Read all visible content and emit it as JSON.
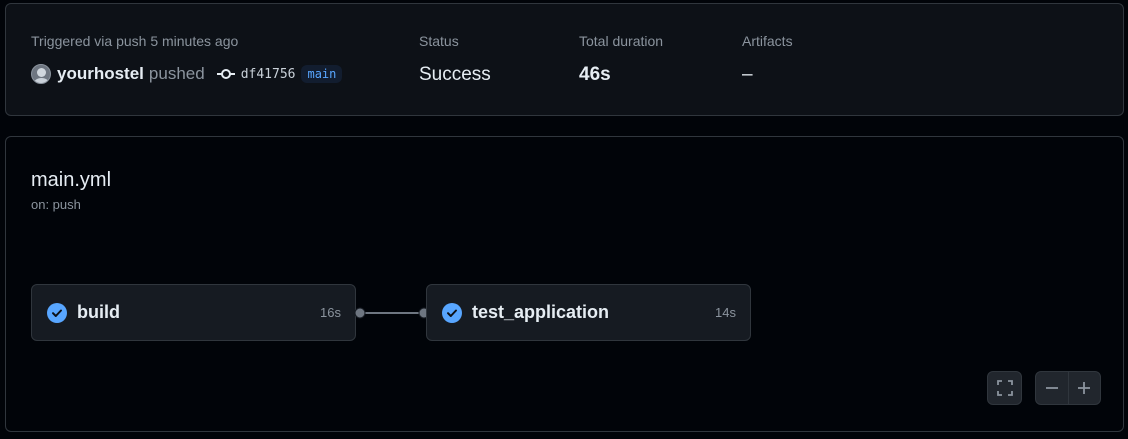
{
  "summary": {
    "trigger_text": "Triggered via push 5 minutes ago",
    "user": "yourhostel",
    "action": "pushed",
    "commit_sha": "df41756",
    "branch": "main",
    "status_label": "Status",
    "status_value": "Success",
    "duration_label": "Total duration",
    "duration_value": "46s",
    "artifacts_label": "Artifacts",
    "artifacts_value": "–"
  },
  "workflow": {
    "title": "main.yml",
    "subtitle": "on: push",
    "jobs": [
      {
        "name": "build",
        "duration": "16s",
        "status": "success"
      },
      {
        "name": "test_application",
        "duration": "14s",
        "status": "success"
      }
    ]
  },
  "colors": {
    "success_check": "#58a6ff",
    "panel_bg": "#0d1117",
    "border": "#30363d"
  },
  "icons": [
    "avatar",
    "commit-icon",
    "check-circle-icon",
    "fullscreen-icon",
    "zoom-out-icon",
    "zoom-in-icon"
  ]
}
